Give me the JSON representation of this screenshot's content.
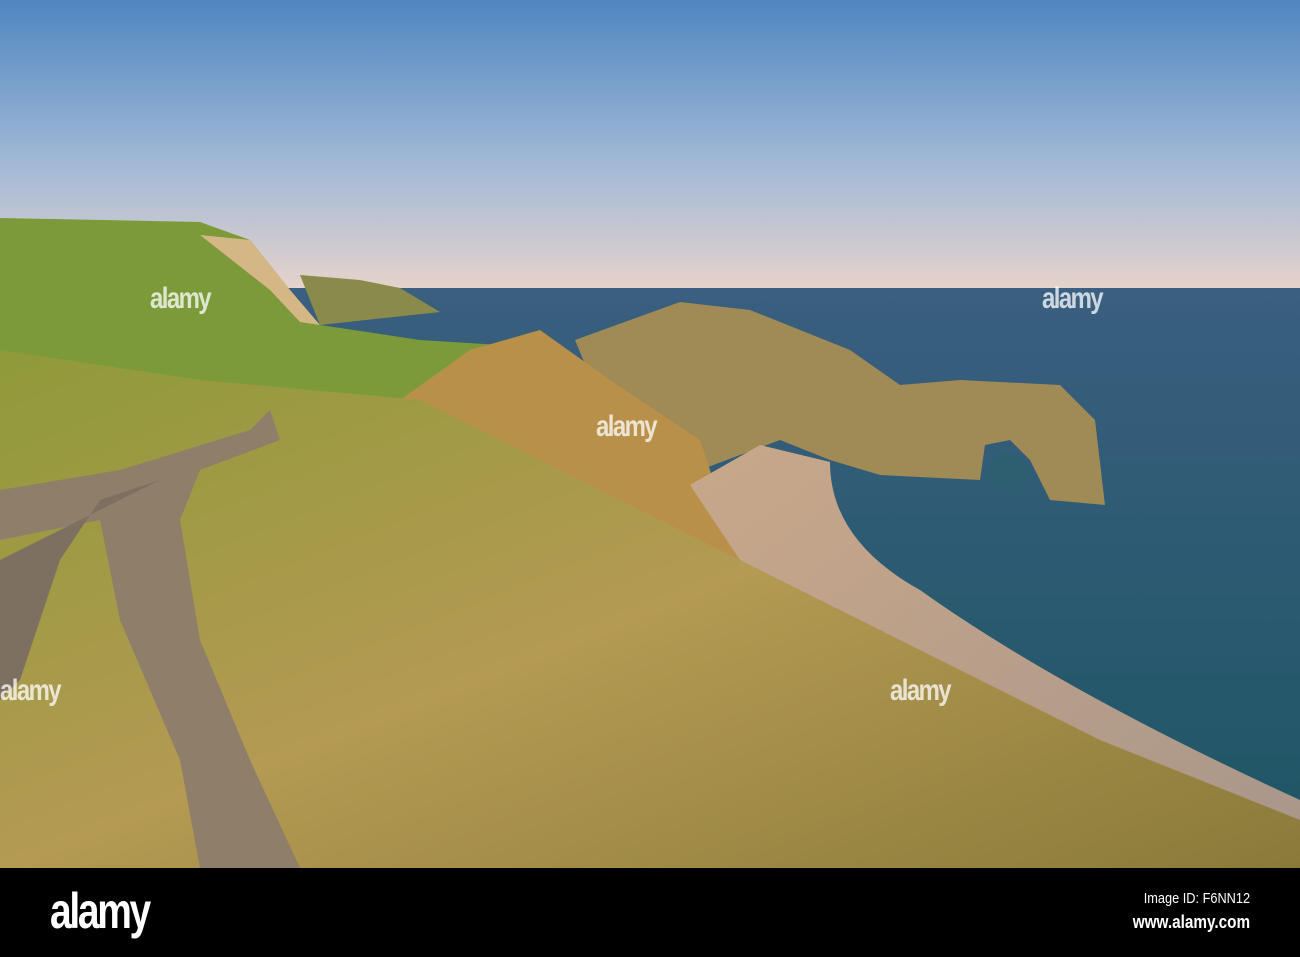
{
  "photo": {
    "subject": "Durdle Door coastal landscape at sunset",
    "watermark_text": "alamy"
  },
  "footer": {
    "logo": "alamy",
    "image_id": "Image ID: F6NN12",
    "url": "www.alamy.com"
  }
}
